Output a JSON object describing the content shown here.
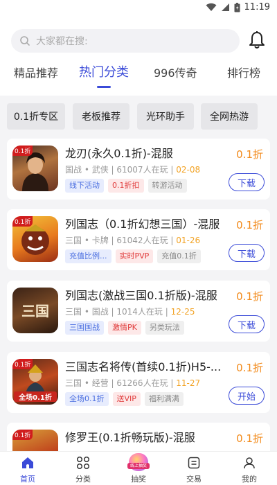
{
  "status_bar": {
    "time": "11:19"
  },
  "search": {
    "placeholder": "大家都在搜:"
  },
  "tabs": [
    {
      "label": "精品推荐"
    },
    {
      "label": "热门分类"
    },
    {
      "label": "996传奇"
    },
    {
      "label": "排行榜"
    }
  ],
  "active_tab": "热门分类",
  "chips": [
    {
      "label": "0.1折专区"
    },
    {
      "label": "老板推荐"
    },
    {
      "label": "光环助手"
    },
    {
      "label": "全网热游"
    }
  ],
  "games": [
    {
      "name": "龙刃(永久0.1折)-混服",
      "category": "国战 • 武侠",
      "players": "61007人在玩",
      "date": "02-08",
      "tags": [
        "线下活动",
        "0.1折扣",
        "转游活动"
      ],
      "discount": "0.1折",
      "button": "下载",
      "icon_corner": "0.1折",
      "icon_text": ""
    },
    {
      "name": "列国志（0.1折幻想三国）-混服",
      "category": "三国 • 卡牌",
      "players": "61042人在玩",
      "date": "01-26",
      "tags": [
        "充值比例...",
        "实时PVP",
        "充值0.1折"
      ],
      "discount": "0.1折",
      "button": "下载",
      "icon_corner": "0.1折",
      "icon_text": ""
    },
    {
      "name": "列国志(激战三国0.1折版)-混服",
      "category": "三国 • 国战",
      "players": "1014人在玩",
      "date": "12-25",
      "tags": [
        "三国国战",
        "激情PK",
        "另类玩法"
      ],
      "discount": "0.1折",
      "button": "下载",
      "icon_corner": "",
      "icon_text": "三国"
    },
    {
      "name": "三国志名将传(首续0.1折)H5-...",
      "category": "三国 • 经营",
      "players": "61266人在玩",
      "date": "11-27",
      "tags": [
        "全场0.1折",
        "送VIP",
        "福利满满"
      ],
      "discount": "0.1折",
      "button": "开始",
      "icon_corner": "0.1折",
      "icon_text": "全场0.1折"
    },
    {
      "name": "修罗王(0.1折畅玩版)-混服",
      "category": "",
      "players": "",
      "date": "",
      "tags": [],
      "discount": "0.1折",
      "button": "",
      "icon_corner": "0.1折",
      "icon_text": ""
    }
  ],
  "bottom_nav": [
    {
      "label": "首页",
      "icon": "home-icon"
    },
    {
      "label": "分类",
      "icon": "grid-icon"
    },
    {
      "label": "抽奖",
      "icon": "lottery-icon",
      "badge": "线上抽奖"
    },
    {
      "label": "交易",
      "icon": "trade-icon"
    },
    {
      "label": "我的",
      "icon": "profile-icon"
    }
  ],
  "active_nav": "首页",
  "colors": {
    "accent": "#3b4bd8",
    "discount": "#f28a1a",
    "date": "#f2a325"
  }
}
